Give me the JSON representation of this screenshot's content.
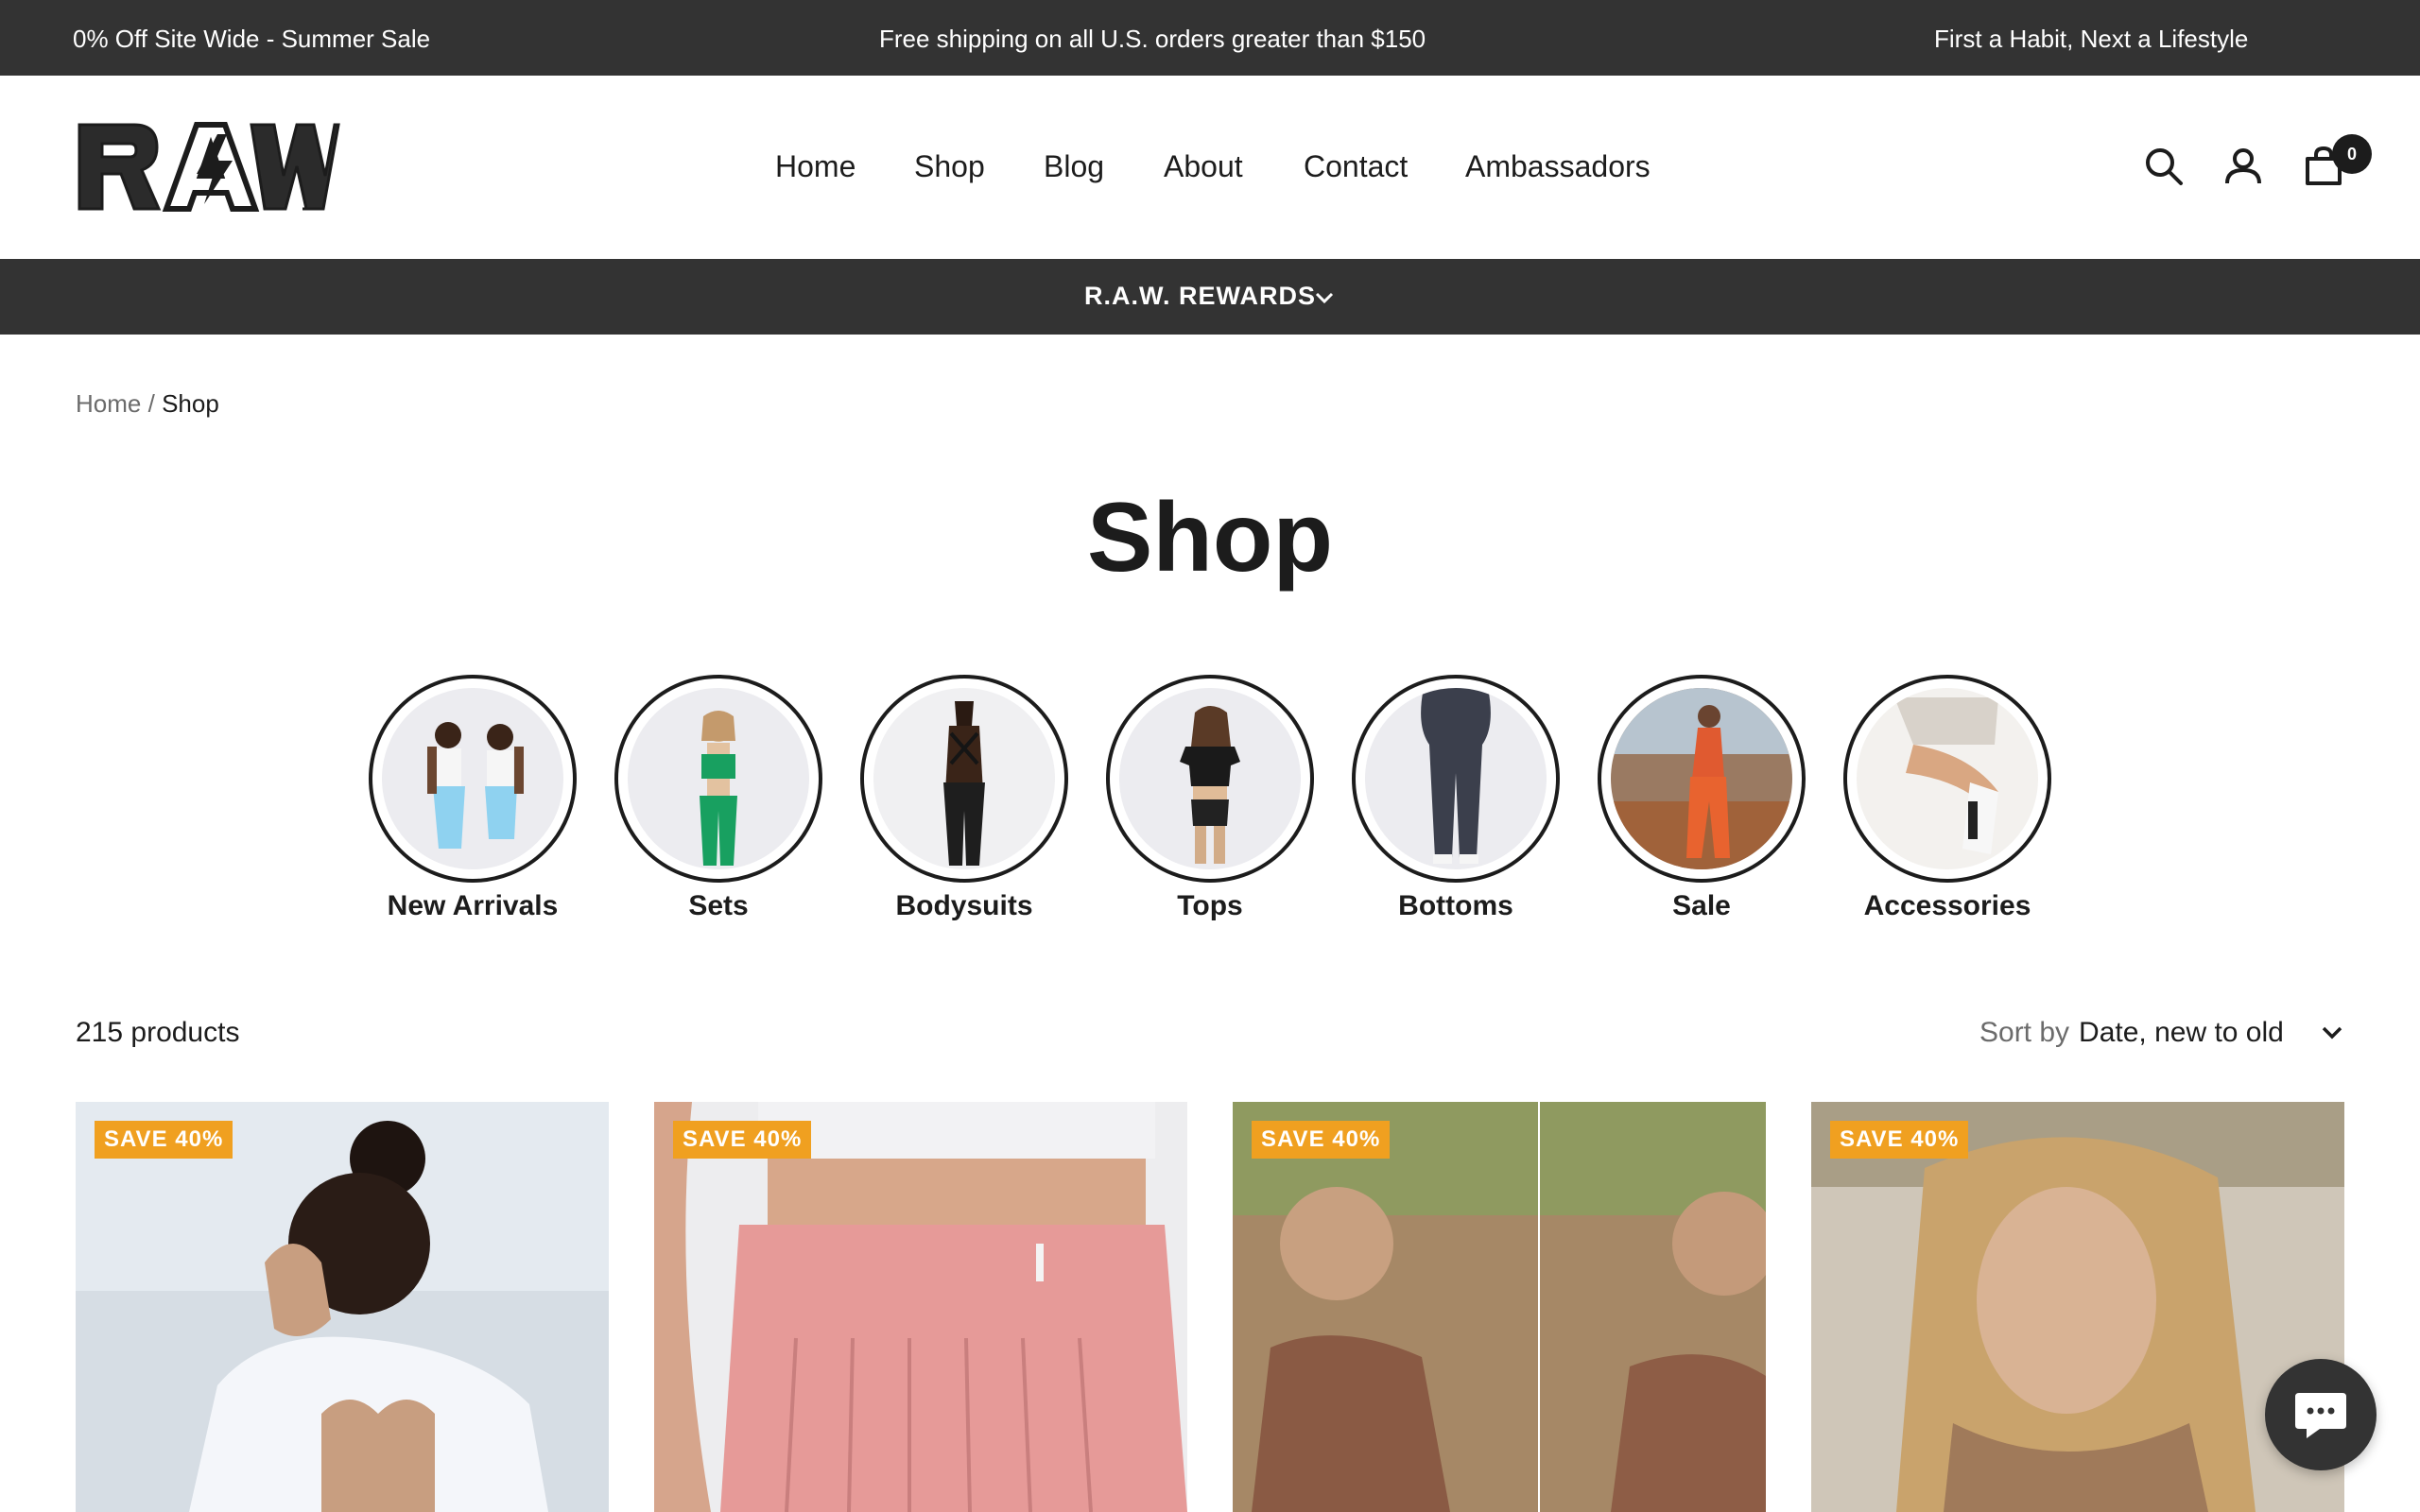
{
  "announcement": {
    "left": "0% Off Site Wide - Summer Sale",
    "center": "Free shipping on all U.S. orders greater than $150",
    "right": "First a Habit, Next a Lifestyle"
  },
  "header": {
    "logo_text": "RAW",
    "nav": [
      "Home",
      "Shop",
      "Blog",
      "About",
      "Contact",
      "Ambassadors"
    ],
    "cart_count": "0",
    "icons": [
      "search-icon",
      "account-icon",
      "cart-icon"
    ]
  },
  "rewards": {
    "label": "R.A.W. REWARDS"
  },
  "breadcrumb": {
    "home": "Home",
    "separator": "/",
    "current": "Shop"
  },
  "page": {
    "title": "Shop"
  },
  "categories": [
    {
      "label": "New Arrivals"
    },
    {
      "label": "Sets"
    },
    {
      "label": "Bodysuits"
    },
    {
      "label": "Tops"
    },
    {
      "label": "Bottoms"
    },
    {
      "label": "Sale"
    },
    {
      "label": "Accessories"
    }
  ],
  "toolbar": {
    "product_count": "215 products",
    "sort_label": "Sort by",
    "sort_value": "Date, new to old"
  },
  "products": [
    {
      "badge": "SAVE 40%"
    },
    {
      "badge": "SAVE 40%"
    },
    {
      "badge": "SAVE 40%"
    },
    {
      "badge": "SAVE 40%"
    }
  ],
  "colors": {
    "bar_bg": "#333333",
    "badge_bg": "#f0a020",
    "text": "#1c1c1c",
    "muted": "#6b6b6b"
  }
}
